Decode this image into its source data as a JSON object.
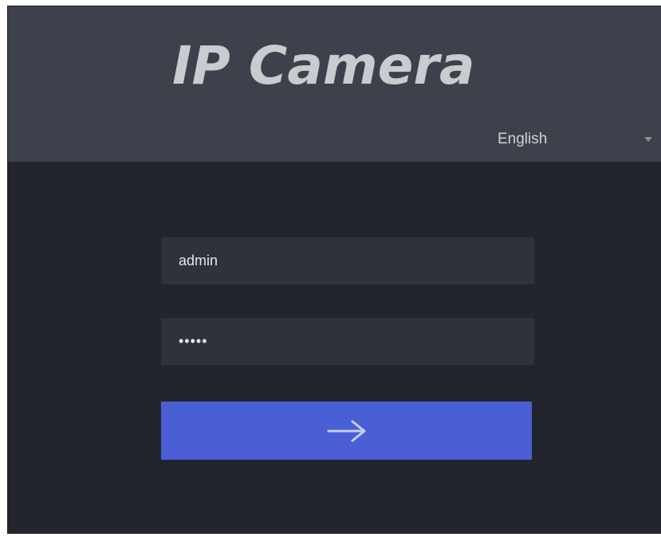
{
  "app": {
    "title": "IP Camera"
  },
  "language_select": {
    "selected": "English",
    "icon": "chevron-down-icon"
  },
  "login": {
    "username": "admin",
    "password_masked": "•••••",
    "submit_icon": "arrow-right-icon"
  },
  "colors": {
    "header_bg": "#3d414c",
    "body_bg": "#22252d",
    "field_bg": "#2f323a",
    "button_bg": "#4a5fd3",
    "title_text": "#c9cbce"
  }
}
